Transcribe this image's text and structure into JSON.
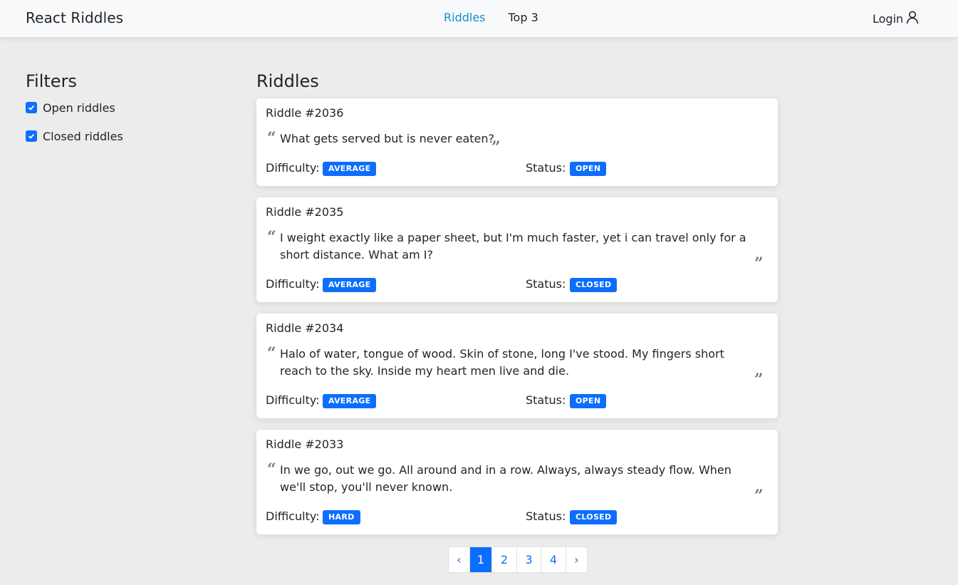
{
  "navbar": {
    "brand": "React Riddles",
    "links": [
      {
        "label": "Riddles",
        "active": true
      },
      {
        "label": "Top 3",
        "active": false
      }
    ],
    "login_label": "Login",
    "login_icon": "user-icon"
  },
  "filters": {
    "title": "Filters",
    "options": [
      {
        "label": "Open riddles",
        "checked": true
      },
      {
        "label": "Closed riddles",
        "checked": true
      }
    ]
  },
  "main": {
    "title": "Riddles",
    "difficulty_label": "Difficulty:",
    "status_label": "Status:",
    "riddles": [
      {
        "title": "Riddle #2036",
        "text": "What gets served but is never eaten?",
        "difficulty": "AVERAGE",
        "status": "OPEN"
      },
      {
        "title": "Riddle #2035",
        "text": "I weight exactly like a paper sheet, but I'm much faster, yet i can travel only for a short distance. What am I?",
        "difficulty": "AVERAGE",
        "status": "CLOSED"
      },
      {
        "title": "Riddle #2034",
        "text": "Halo of water, tongue of wood. Skin of stone, long I've stood. My fingers short reach to the sky. Inside my heart men live and die.",
        "difficulty": "AVERAGE",
        "status": "OPEN"
      },
      {
        "title": "Riddle #2033",
        "text": "In we go, out we go. All around and in a row. Always, always steady flow. When we'll stop, you'll never known.",
        "difficulty": "HARD",
        "status": "CLOSED"
      }
    ]
  },
  "pagination": {
    "prev": "‹",
    "pages": [
      "1",
      "2",
      "3",
      "4"
    ],
    "current": "1",
    "next": "›"
  },
  "colors": {
    "accent": "#0d6efd",
    "active_nav": "#0d8fd6",
    "background": "#ececec"
  }
}
